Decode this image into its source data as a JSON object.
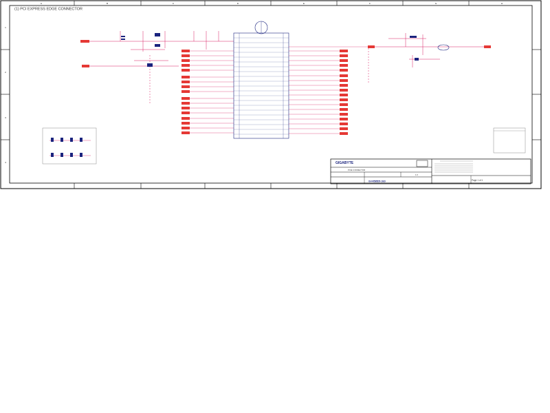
{
  "sheet": {
    "title": "(1) PCI EXPRESS EDGE CONNECTOR",
    "col_markers": [
      "A",
      "B",
      "C",
      "D",
      "E",
      "F",
      "G",
      "H"
    ],
    "row_markers": [
      "1",
      "2",
      "3",
      "4"
    ]
  },
  "title_block": {
    "company": "GIGABYTE",
    "document_name": "PCIE CONNECTOR",
    "project_code": "GV-R585D5-1GD",
    "page_label": "Page 1 of 1",
    "revision": "1.0"
  },
  "colors": {
    "wire": "#d81b60",
    "component": "#1a237e",
    "label_fill": "#e53935",
    "border": "#000000",
    "text": "#333333"
  }
}
